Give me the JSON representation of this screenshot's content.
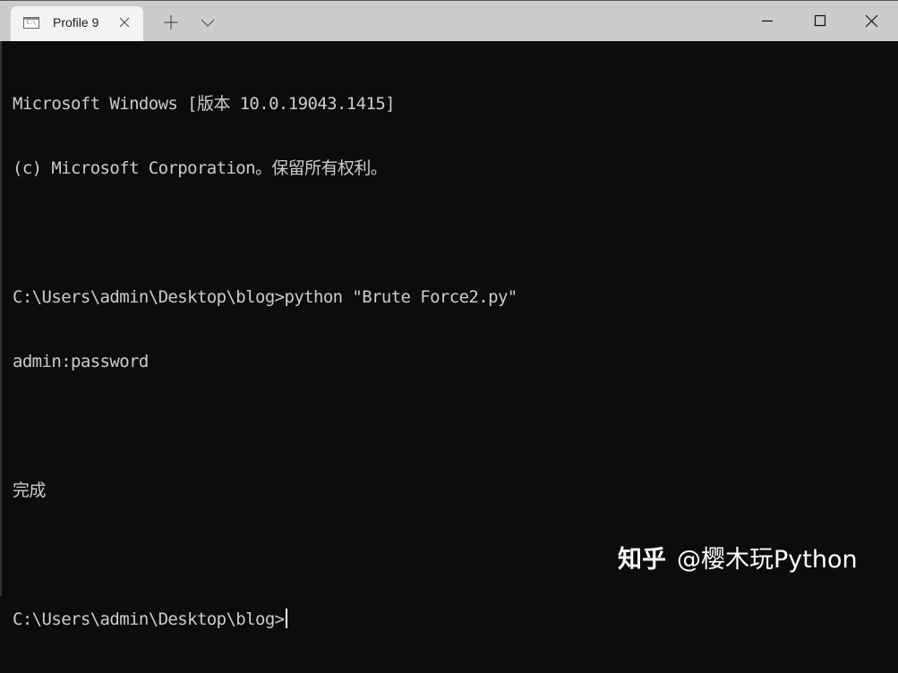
{
  "window": {
    "tabs": [
      {
        "title": "Profile 9",
        "icon": "command-prompt-icon",
        "active": true
      }
    ],
    "new_tab_icon": "plus-icon",
    "dropdown_icon": "chevron-down-icon",
    "controls": {
      "minimize_icon": "minimize-icon",
      "maximize_icon": "maximize-icon",
      "close_icon": "close-icon"
    }
  },
  "terminal": {
    "lines": [
      "Microsoft Windows [版本 10.0.19043.1415]",
      "(c) Microsoft Corporation。保留所有权利。",
      "",
      "C:\\Users\\admin\\Desktop\\blog>python \"Brute Force2.py\"",
      "admin:password",
      "",
      "完成",
      ""
    ],
    "prompt": "C:\\Users\\admin\\Desktop\\blog>"
  },
  "watermark": {
    "brand": "知乎",
    "author": "@樱木玩Python"
  },
  "colors": {
    "terminal_bg": "#0c0c0c",
    "terminal_fg": "#cccccc",
    "titlebar_bg": "#cccccc",
    "tab_bg": "#f3f3f3"
  }
}
